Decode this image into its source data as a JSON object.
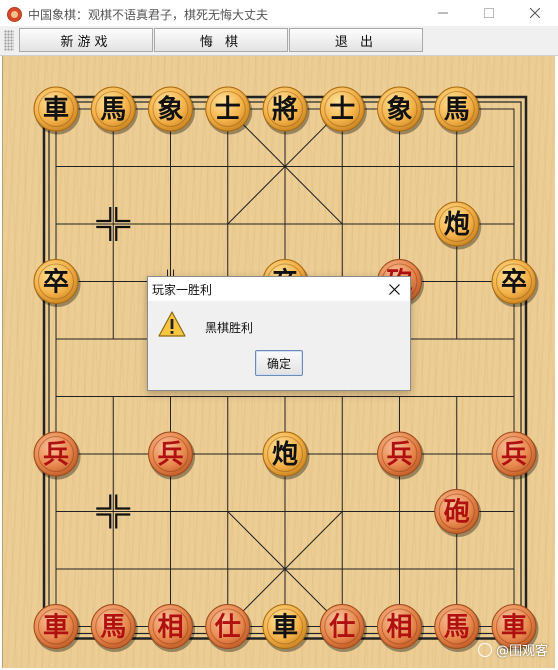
{
  "window": {
    "title": "中国象棋：观棋不语真君子，棋死无悔大丈夫"
  },
  "toolbar": {
    "new_game": "新游戏",
    "undo": "悔 棋",
    "exit": "退 出"
  },
  "board": {
    "files": 9,
    "ranks": 10,
    "wood_color": "#eccd93",
    "line_color": "#222222",
    "last_move_from": {
      "file": 1,
      "rank": 2
    },
    "last_move_to": {
      "file": 1,
      "rank": 7
    },
    "pieces": [
      {
        "side": "black",
        "label": "車",
        "file": 0,
        "rank": 0
      },
      {
        "side": "black",
        "label": "馬",
        "file": 1,
        "rank": 0
      },
      {
        "side": "black",
        "label": "象",
        "file": 2,
        "rank": 0
      },
      {
        "side": "black",
        "label": "士",
        "file": 3,
        "rank": 0
      },
      {
        "side": "black",
        "label": "將",
        "file": 4,
        "rank": 0
      },
      {
        "side": "black",
        "label": "士",
        "file": 5,
        "rank": 0
      },
      {
        "side": "black",
        "label": "象",
        "file": 6,
        "rank": 0
      },
      {
        "side": "black",
        "label": "馬",
        "file": 7,
        "rank": 0
      },
      {
        "side": "black",
        "label": "炮",
        "file": 7,
        "rank": 2
      },
      {
        "side": "black",
        "label": "卒",
        "file": 0,
        "rank": 3
      },
      {
        "side": "black",
        "label": "卒",
        "file": 4,
        "rank": 3
      },
      {
        "side": "black",
        "label": "卒",
        "file": 8,
        "rank": 3
      },
      {
        "side": "red",
        "label": "砲",
        "file": 6,
        "rank": 3
      },
      {
        "side": "red",
        "label": "兵",
        "file": 0,
        "rank": 6
      },
      {
        "side": "red",
        "label": "兵",
        "file": 2,
        "rank": 6
      },
      {
        "side": "black",
        "label": "炮",
        "file": 4,
        "rank": 6
      },
      {
        "side": "red",
        "label": "兵",
        "file": 6,
        "rank": 6
      },
      {
        "side": "red",
        "label": "兵",
        "file": 8,
        "rank": 6
      },
      {
        "side": "red",
        "label": "砲",
        "file": 7,
        "rank": 7
      },
      {
        "side": "red",
        "label": "車",
        "file": 0,
        "rank": 9
      },
      {
        "side": "red",
        "label": "馬",
        "file": 1,
        "rank": 9
      },
      {
        "side": "red",
        "label": "相",
        "file": 2,
        "rank": 9
      },
      {
        "side": "red",
        "label": "仕",
        "file": 3,
        "rank": 9
      },
      {
        "side": "black",
        "label": "車",
        "file": 4,
        "rank": 9
      },
      {
        "side": "red",
        "label": "仕",
        "file": 5,
        "rank": 9
      },
      {
        "side": "red",
        "label": "相",
        "file": 6,
        "rank": 9
      },
      {
        "side": "red",
        "label": "馬",
        "file": 7,
        "rank": 9
      },
      {
        "side": "red",
        "label": "車",
        "file": 8,
        "rank": 9
      }
    ]
  },
  "dialog": {
    "title": "玩家一胜利",
    "message": "黑棋胜利",
    "ok_label": "确定",
    "icon": "warning-icon"
  },
  "watermark": {
    "text": "@围观客"
  },
  "colors": {
    "red_piece_text": "#b01010",
    "black_piece_text": "#111111",
    "red_piece_face": "#e8894f",
    "black_piece_face": "#f4b24a"
  }
}
